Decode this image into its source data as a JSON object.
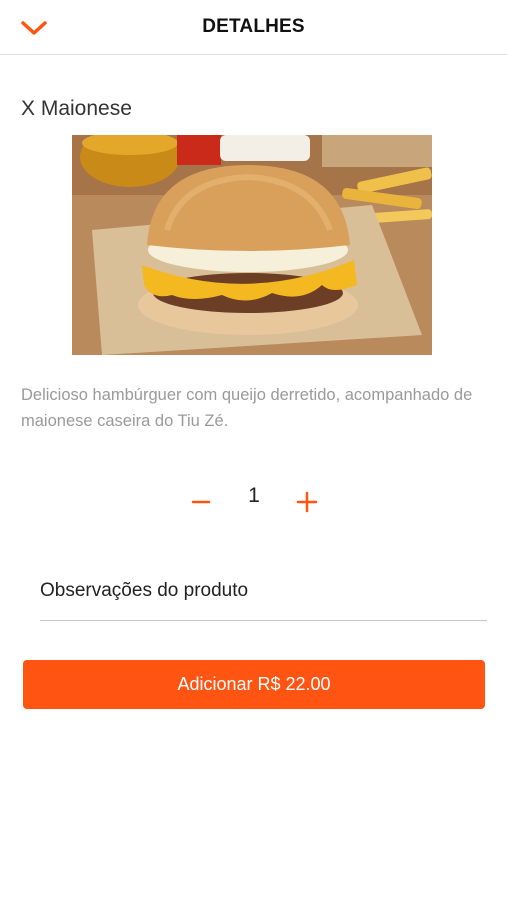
{
  "header": {
    "title": "DETALHES",
    "back_icon": "chevron-down-icon"
  },
  "product": {
    "name": "X Maionese",
    "image_alt": "hamburger-photo",
    "description": "Delicioso hambúrguer com queijo derretido, acompanhado de maionese caseira do Tiu Zé."
  },
  "quantity": {
    "minus_symbol": "−",
    "value": "1",
    "plus_symbol": "+"
  },
  "notes": {
    "placeholder": "Observações do produto"
  },
  "action": {
    "add_label": "Adicionar R$ 22.00"
  },
  "colors": {
    "accent": "#ff5412",
    "description_text": "#9a9a9a"
  }
}
